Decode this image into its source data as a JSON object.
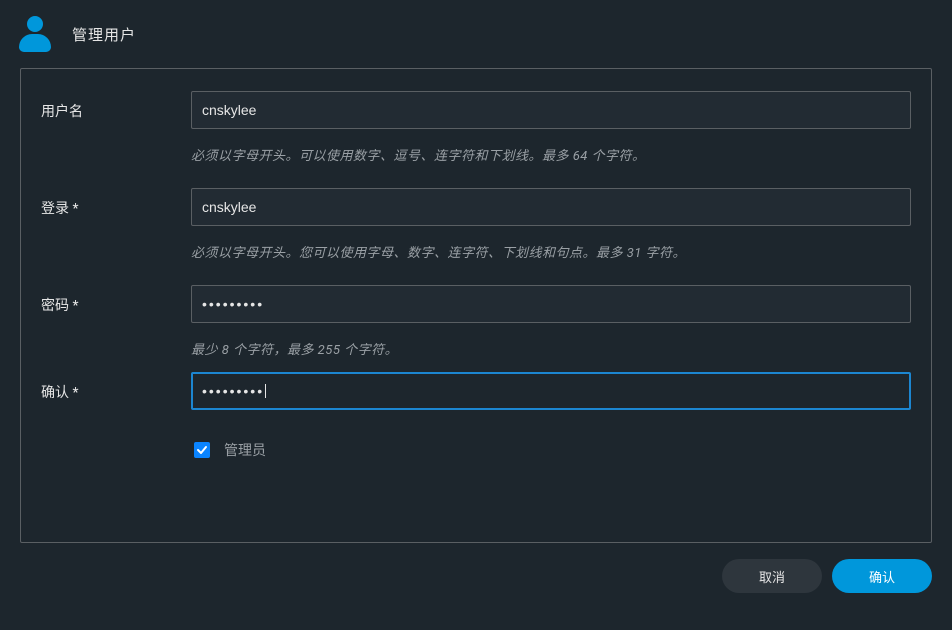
{
  "header": {
    "title": "管理用户"
  },
  "form": {
    "username": {
      "label": "用户名",
      "value": "cnskylee",
      "hint": "必须以字母开头。可以使用数字、逗号、连字符和下划线。最多 64 个字符。"
    },
    "login": {
      "label": "登录 *",
      "value": "cnskylee",
      "hint": "必须以字母开头。您可以使用字母、数字、连字符、下划线和句点。最多 31 字符。"
    },
    "password": {
      "label": "密码 *",
      "value": "•••••••••",
      "hint": "最少 8 个字符，最多 255 个字符。"
    },
    "confirm": {
      "label": "确认 *",
      "value": "•••••••••"
    },
    "admin": {
      "label": "管理员",
      "checked": true
    }
  },
  "footer": {
    "cancel": "取消",
    "confirm": "确认"
  }
}
